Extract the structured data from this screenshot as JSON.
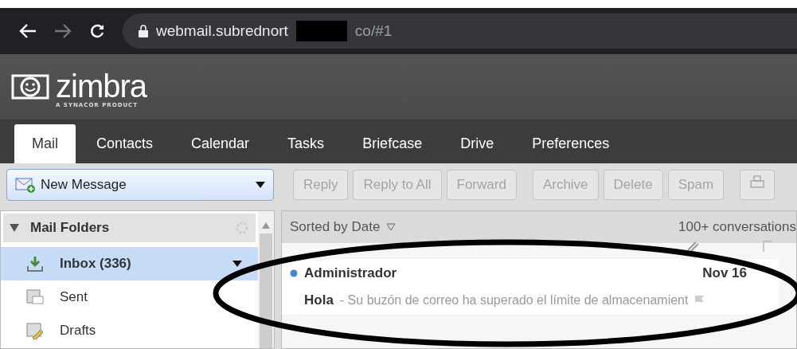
{
  "browser": {
    "url_start": "webmail.subrednort",
    "url_end": "co/#1"
  },
  "brand": {
    "logo": "zimbra",
    "tagline": "A SYNACOR PRODUCT"
  },
  "tabs": [
    {
      "label": "Mail",
      "selected": true
    },
    {
      "label": "Contacts",
      "selected": false
    },
    {
      "label": "Calendar",
      "selected": false
    },
    {
      "label": "Tasks",
      "selected": false
    },
    {
      "label": "Briefcase",
      "selected": false
    },
    {
      "label": "Drive",
      "selected": false
    },
    {
      "label": "Preferences",
      "selected": false
    }
  ],
  "new_message": {
    "label": "New Message"
  },
  "toolbar_buttons": [
    {
      "label": "Reply",
      "disabled": true,
      "gap_before": false
    },
    {
      "label": "Reply to All",
      "disabled": true,
      "gap_before": false
    },
    {
      "label": "Forward",
      "disabled": true,
      "gap_before": false
    },
    {
      "label": "Archive",
      "disabled": true,
      "gap_before": true
    },
    {
      "label": "Delete",
      "disabled": true,
      "gap_before": false
    },
    {
      "label": "Spam",
      "disabled": true,
      "gap_before": false
    }
  ],
  "folders": {
    "title": "Mail Folders",
    "expanded": true,
    "items": [
      {
        "kind": "inbox",
        "label": "Inbox (336)",
        "selected": true
      },
      {
        "kind": "sent",
        "label": "Sent",
        "selected": false
      },
      {
        "kind": "drafts",
        "label": "Drafts",
        "selected": false
      }
    ]
  },
  "list": {
    "sort_label": "Sorted by Date",
    "count": "100+ conversations",
    "messages": [
      {
        "kind": "partial"
      },
      {
        "kind": "full",
        "unread": true,
        "sender": "Administrador",
        "date": "Nov 16",
        "subject": "Hola",
        "preview": " - Su buzón de correo ha superado el límite de almacenamient"
      }
    ]
  }
}
